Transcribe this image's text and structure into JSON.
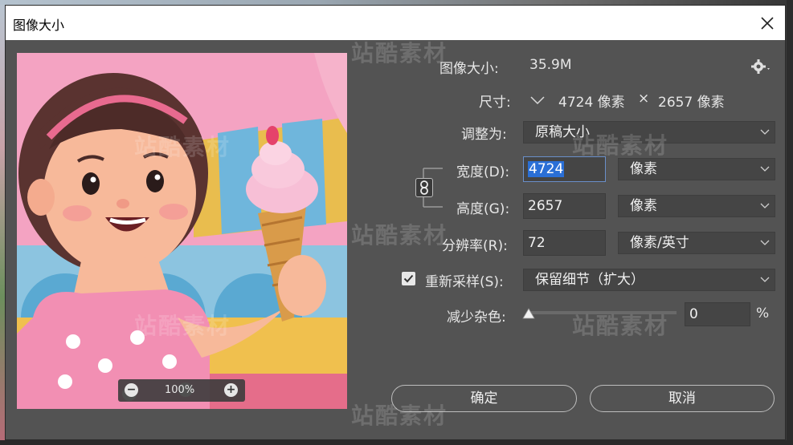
{
  "dialog": {
    "title": "图像大小",
    "close_icon": "close-icon"
  },
  "preview": {
    "zoom": "100%",
    "zoom_out_icon": "zoom-out-icon",
    "zoom_in_icon": "zoom-in-icon"
  },
  "info": {
    "image_size_label": "图像大小:",
    "image_size_value": "35.9M",
    "dimensions_label": "尺寸:",
    "dimensions_width": "4724 像素",
    "dimensions_times": "×",
    "dimensions_height": "2657 像素"
  },
  "fit_to": {
    "label": "调整为:",
    "value": "原稿大小"
  },
  "width": {
    "label": "宽度(D):",
    "value": "4724",
    "unit": "像素"
  },
  "height": {
    "label": "高度(G):",
    "value": "2657",
    "unit": "像素"
  },
  "resolution": {
    "label": "分辨率(R):",
    "value": "72",
    "unit": "像素/英寸"
  },
  "resample": {
    "label": "重新采样(S):",
    "checked": true,
    "method": "保留细节（扩大）"
  },
  "noise": {
    "label": "减少杂色:",
    "value": "0",
    "unit": "%",
    "slider_level": 0
  },
  "buttons": {
    "ok": "确定",
    "cancel": "取消"
  },
  "watermark_text": "站酷素材",
  "colors": {
    "dialog_bg": "#535353",
    "field_bg": "#454545",
    "highlight": "#2a6fd6",
    "text": "#e6e6e6"
  }
}
